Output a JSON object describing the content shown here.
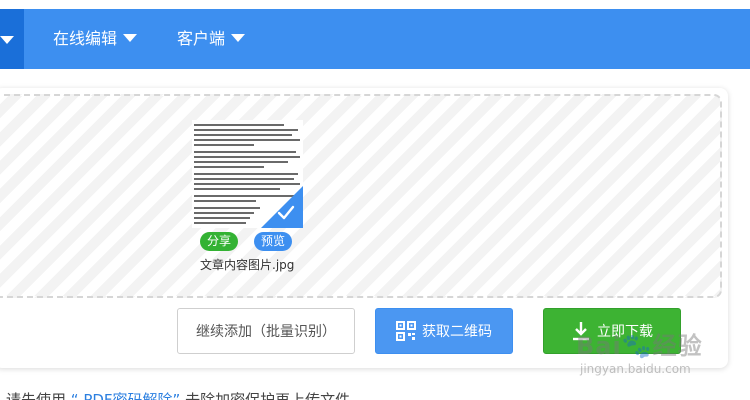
{
  "navbar": {
    "items": [
      {
        "label": "在线编辑"
      },
      {
        "label": "客户端"
      }
    ],
    "bg_color": "#3d8ff0"
  },
  "upload": {
    "file": {
      "name": "文章内容图片.jpg",
      "share_label": "分享",
      "preview_label": "预览",
      "selected": true
    }
  },
  "actions": {
    "continue_label": "继续添加（批量识别）",
    "qrcode_label": "获取二维码",
    "download_label": "立即下载"
  },
  "hint": {
    "prefix": "请先使用",
    "link": "“ PDF密码解除”",
    "suffix": "去除加密保护再上传文件"
  },
  "watermark": {
    "main": "Bai🐾经验",
    "sub": "jingyan.baidu.com"
  },
  "colors": {
    "accent": "#3d8ff0",
    "success": "#3db333"
  }
}
